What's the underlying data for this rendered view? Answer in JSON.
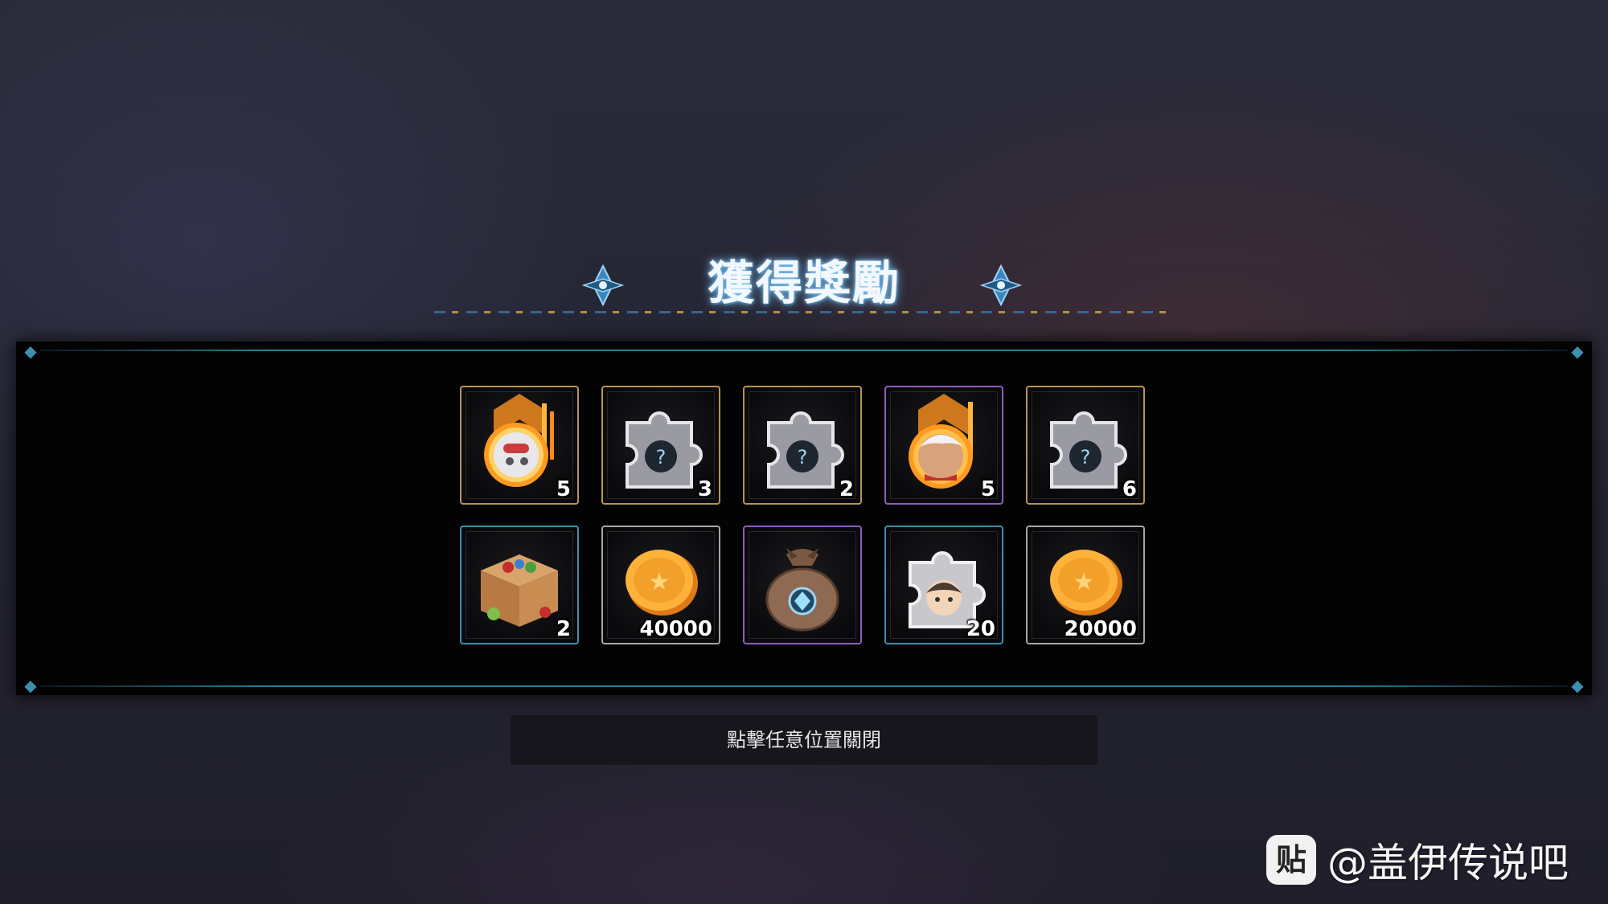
{
  "title": "獲得獎勵",
  "rewards": [
    {
      "icon": "rank-up-badge-robot-icon",
      "count": "5",
      "rarity": "gold"
    },
    {
      "icon": "puzzle-piece-icon",
      "count": "3",
      "rarity": "gold"
    },
    {
      "icon": "puzzle-piece-icon",
      "count": "2",
      "rarity": "gold"
    },
    {
      "icon": "rank-up-badge-hero-icon",
      "count": "5",
      "rarity": "purple"
    },
    {
      "icon": "puzzle-piece-icon",
      "count": "6",
      "rarity": "gold"
    },
    {
      "icon": "supply-box-icon",
      "count": "2",
      "rarity": "blue"
    },
    {
      "icon": "gold-coin-icon",
      "count": "40000",
      "rarity": "silver"
    },
    {
      "icon": "gem-pouch-icon",
      "count": "",
      "rarity": "purple"
    },
    {
      "icon": "character-puzzle-piece-icon",
      "count": "20",
      "rarity": "blue"
    },
    {
      "icon": "gold-coin-icon",
      "count": "20000",
      "rarity": "silver"
    }
  ],
  "close_hint": "點擊任意位置關閉",
  "watermark": {
    "logo_text": "贴",
    "text": "@盖伊传说吧"
  },
  "colors": {
    "gold_frame": "#b89352",
    "purple_frame": "#8e5cc0",
    "blue_frame": "#3c8fb0",
    "silver_frame": "#a6a6a6",
    "title_glow": "#78c8ff"
  }
}
